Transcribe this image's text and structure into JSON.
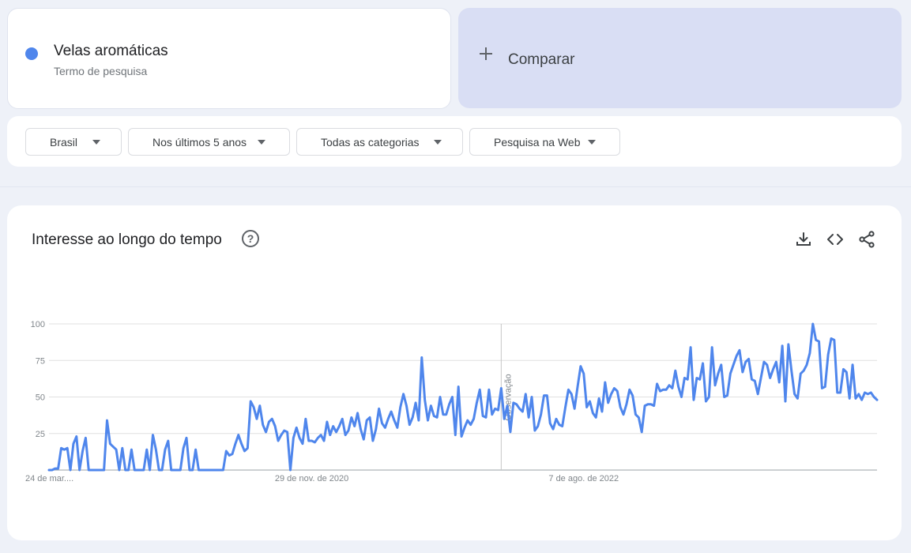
{
  "search_term": {
    "name": "Velas aromáticas",
    "subtitle": "Termo de pesquisa",
    "color": "#4f86ec"
  },
  "compare": {
    "label": "Comparar"
  },
  "filters": [
    {
      "label": "Brasil"
    },
    {
      "label": "Nos últimos 5 anos"
    },
    {
      "label": "Todas as categorias"
    },
    {
      "label": "Pesquisa na Web"
    }
  ],
  "chart_card": {
    "title": "Interesse ao longo do tempo",
    "help_icon": "help-circle-icon",
    "tools": [
      "download-icon",
      "embed-code-icon",
      "share-icon"
    ]
  },
  "chart_data": {
    "type": "line",
    "title": "Interesse ao longo do tempo",
    "xlabel": "",
    "ylabel": "",
    "ylim": [
      0,
      100
    ],
    "yticks": [
      25,
      50,
      75,
      100
    ],
    "grid": true,
    "x_tick_labels": [
      {
        "label": "24 de mar....",
        "index": 0
      },
      {
        "label": "29 de nov. de 2020",
        "index": 86
      },
      {
        "label": "7 de ago. de 2022",
        "index": 175
      }
    ],
    "annotation": {
      "label": "Observação",
      "index": 148
    },
    "series": [
      {
        "color": "#4f86ec",
        "values": [
          0,
          0,
          1,
          1,
          15,
          14,
          15,
          0,
          18,
          23,
          0,
          13,
          22,
          0,
          0,
          0,
          0,
          0,
          0,
          34,
          18,
          16,
          14,
          0,
          15,
          0,
          0,
          14,
          0,
          0,
          0,
          0,
          14,
          0,
          24,
          14,
          0,
          0,
          14,
          20,
          0,
          0,
          0,
          0,
          15,
          22,
          0,
          0,
          14,
          0,
          0,
          0,
          0,
          0,
          0,
          0,
          0,
          0,
          13,
          10,
          11,
          18,
          24,
          18,
          13,
          15,
          47,
          43,
          35,
          44,
          31,
          26,
          33,
          35,
          30,
          20,
          24,
          27,
          26,
          0,
          22,
          29,
          22,
          18,
          35,
          20,
          20,
          19,
          22,
          24,
          20,
          33,
          24,
          30,
          26,
          30,
          35,
          24,
          27,
          36,
          30,
          39,
          28,
          21,
          34,
          36,
          20,
          28,
          42,
          32,
          29,
          35,
          40,
          34,
          29,
          43,
          52,
          44,
          31,
          36,
          46,
          34,
          77,
          48,
          34,
          44,
          37,
          36,
          50,
          38,
          38,
          45,
          50,
          24,
          57,
          23,
          29,
          34,
          31,
          35,
          46,
          55,
          37,
          36,
          55,
          38,
          42,
          41,
          56,
          35,
          44,
          26,
          46,
          45,
          42,
          40,
          52,
          36,
          50,
          27,
          30,
          38,
          51,
          51,
          32,
          28,
          35,
          31,
          30,
          43,
          55,
          52,
          42,
          57,
          71,
          66,
          43,
          47,
          39,
          36,
          49,
          40,
          60,
          46,
          52,
          56,
          54,
          43,
          38,
          45,
          55,
          51,
          38,
          36,
          26,
          44,
          45,
          45,
          44,
          59,
          54,
          55,
          55,
          58,
          56,
          68,
          57,
          50,
          63,
          62,
          84,
          48,
          63,
          62,
          73,
          47,
          50,
          84,
          58,
          66,
          72,
          50,
          51,
          66,
          72,
          78,
          82,
          67,
          74,
          76,
          62,
          61,
          52,
          63,
          74,
          72,
          63,
          69,
          74,
          60,
          85,
          47,
          86,
          68,
          52,
          49,
          66,
          68,
          72,
          80,
          100,
          89,
          88,
          56,
          57,
          79,
          90,
          89,
          53,
          53,
          69,
          67,
          49,
          72,
          49,
          52,
          48,
          53,
          52,
          53,
          50,
          48
        ]
      }
    ]
  }
}
